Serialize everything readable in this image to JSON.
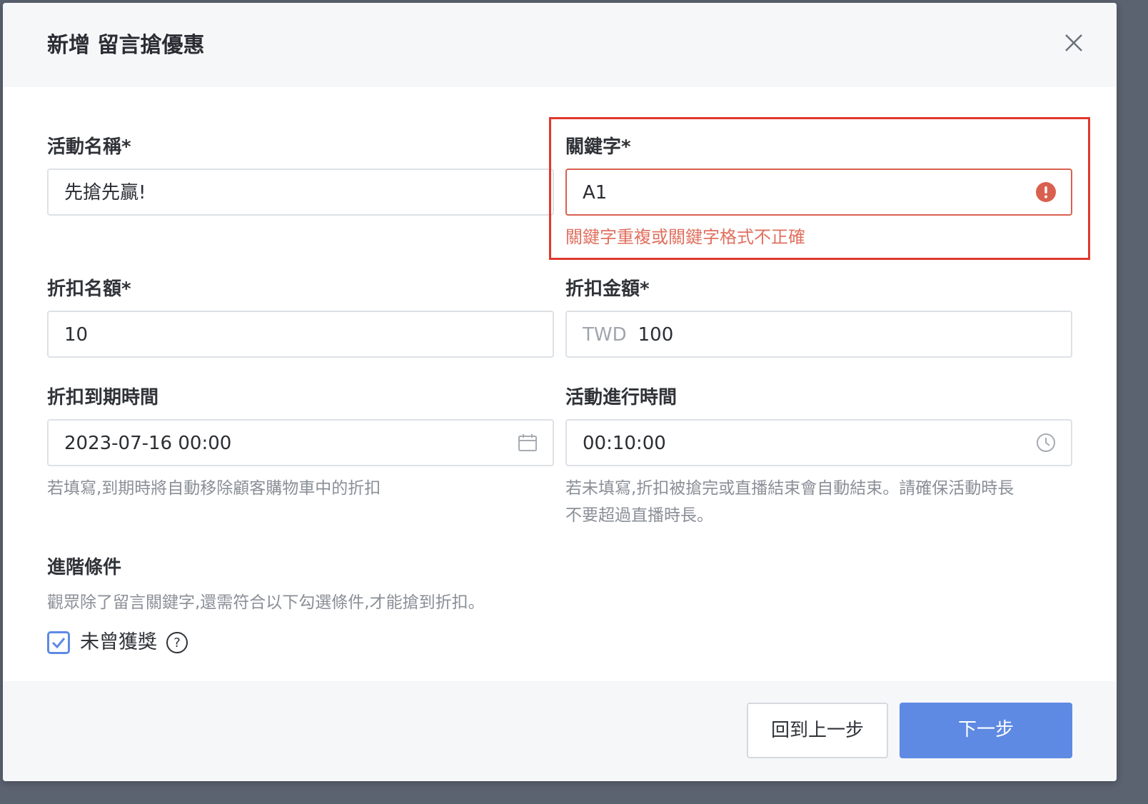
{
  "dialog": {
    "title": "新增 留言搶優惠"
  },
  "form": {
    "event_name": {
      "label": "活動名稱*",
      "value": "先搶先贏!"
    },
    "keyword": {
      "label": "關鍵字*",
      "value": "A1",
      "error": "關鍵字重複或關鍵字格式不正確"
    },
    "quota": {
      "label": "折扣名額*",
      "value": "10"
    },
    "amount": {
      "label": "折扣金額*",
      "currency": "TWD",
      "value": "100"
    },
    "expiry": {
      "label": "折扣到期時間",
      "value": "2023-07-16 00:00",
      "hint": "若填寫,到期時將自動移除顧客購物車中的折扣"
    },
    "duration": {
      "label": "活動進行時間",
      "value": "00:10:00",
      "hint_line1": "若未填寫,折扣被搶完或直播結束會自動結束。請確保活動時長",
      "hint_line2": "不要超過直播時長。"
    },
    "advanced": {
      "title": "進階條件",
      "description": "觀眾除了留言關鍵字,還需符合以下勾選條件,才能搶到折扣。",
      "never_won": {
        "label": "未曾獲獎",
        "checked": true
      }
    }
  },
  "footer": {
    "back_label": "回到上一步",
    "next_label": "下一步"
  },
  "colors": {
    "primary": "#5f8ae3",
    "error": "#d9604f",
    "annotation": "#e0382c"
  }
}
